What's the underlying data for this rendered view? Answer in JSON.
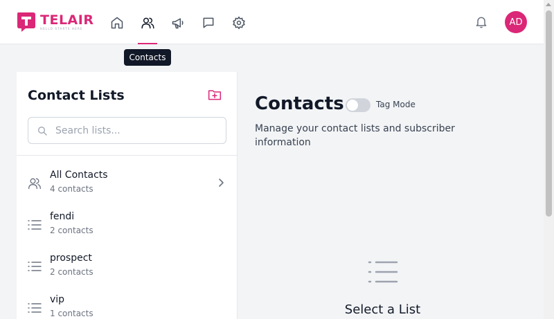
{
  "app": {
    "brand": "TELAIR",
    "tagline": "HELLO STARTS HERE",
    "brand_color": "#db2777"
  },
  "nav": {
    "items": [
      {
        "name": "home",
        "icon": "home-icon",
        "active": false
      },
      {
        "name": "contacts",
        "icon": "users-icon",
        "active": true
      },
      {
        "name": "campaigns",
        "icon": "megaphone-icon",
        "active": false
      },
      {
        "name": "messages",
        "icon": "chat-icon",
        "active": false
      },
      {
        "name": "settings",
        "icon": "gear-icon",
        "active": false
      }
    ],
    "tooltip": "Contacts"
  },
  "user": {
    "initials": "AD"
  },
  "sidebar": {
    "title": "Contact Lists",
    "search_placeholder": "Search lists...",
    "items": [
      {
        "name": "All Contacts",
        "count": "4 contacts",
        "icon": "users-icon"
      },
      {
        "name": "fendi",
        "count": "2 contacts",
        "icon": "list-icon"
      },
      {
        "name": "prospect",
        "count": "2 contacts",
        "icon": "list-icon"
      },
      {
        "name": "vip",
        "count": "1 contacts",
        "icon": "list-icon"
      }
    ]
  },
  "main": {
    "title": "Contacts",
    "tag_mode_label": "Tag Mode",
    "tag_mode_on": false,
    "description": "Manage your contact lists and subscriber information",
    "empty_title": "Select a List"
  }
}
